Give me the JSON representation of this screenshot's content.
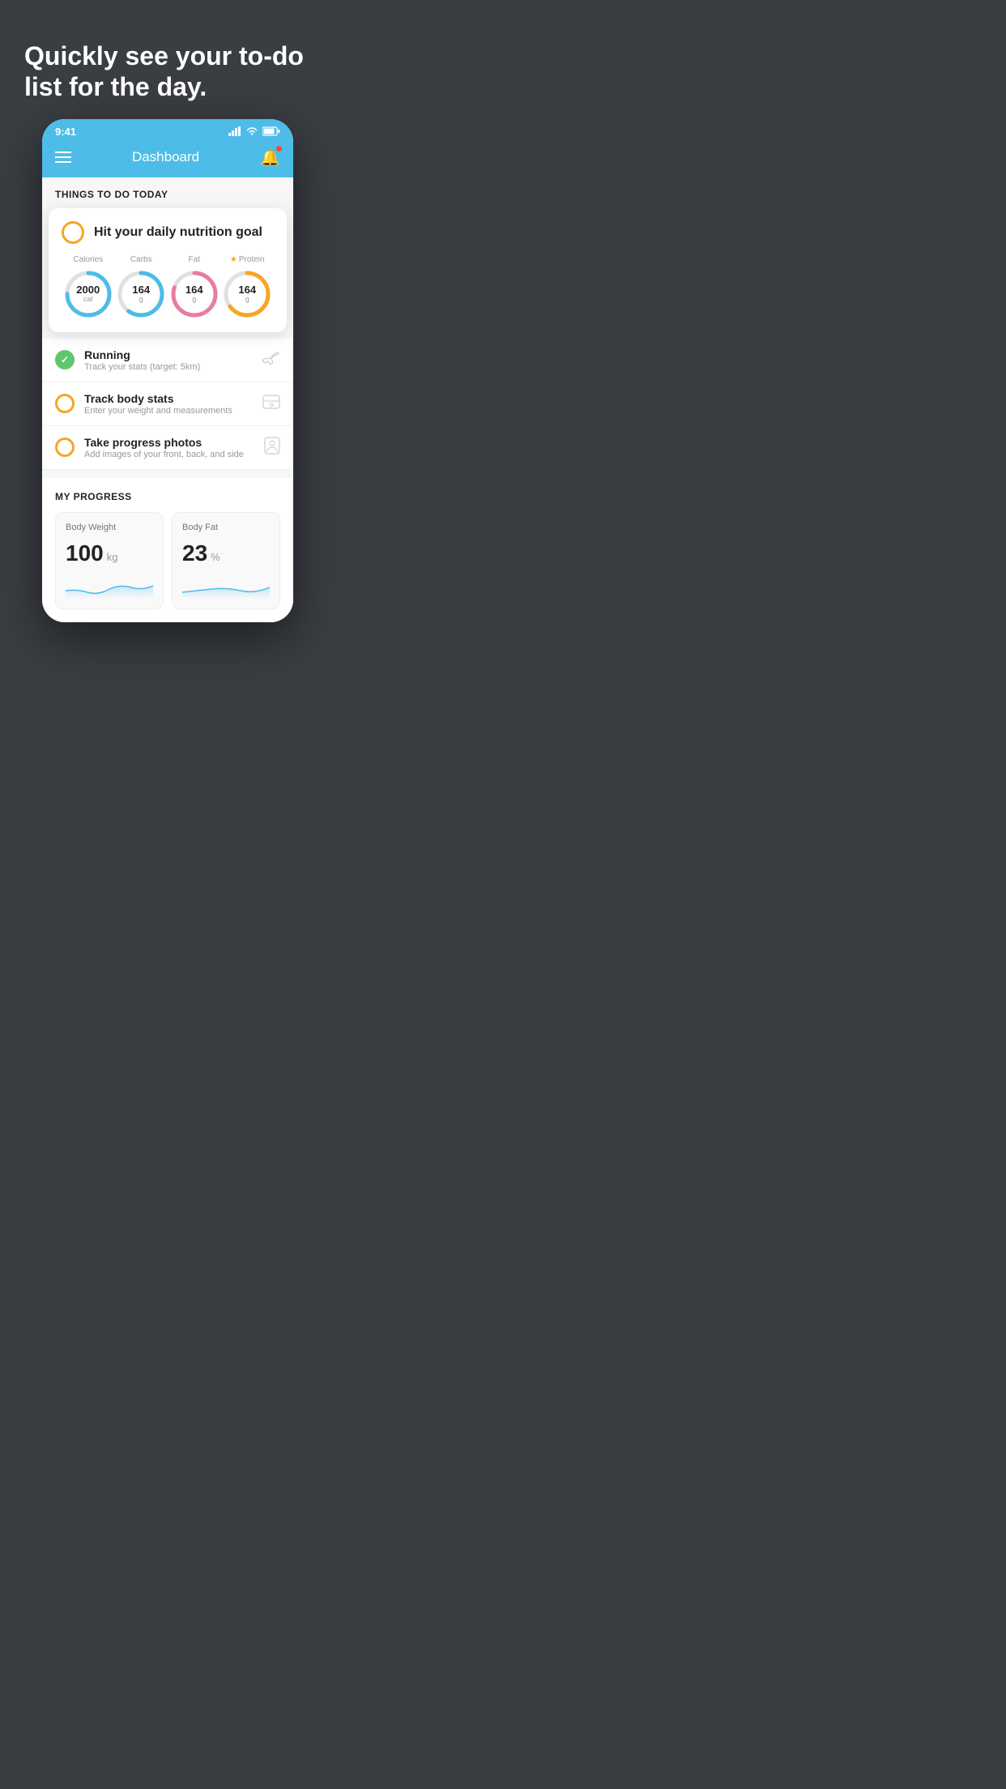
{
  "hero": {
    "title": "Quickly see your to-do list for the day."
  },
  "statusBar": {
    "time": "9:41",
    "signal": "▋▋▋",
    "wifi": "WiFi",
    "battery": "Battery"
  },
  "navbar": {
    "title": "Dashboard",
    "menuLabel": "Menu",
    "notificationLabel": "Notifications"
  },
  "thingsToday": {
    "sectionTitle": "THINGS TO DO TODAY"
  },
  "featuredCard": {
    "title": "Hit your daily nutrition goal",
    "nutrition": [
      {
        "label": "Calories",
        "value": "2000",
        "unit": "cal",
        "color": "#4dbce9",
        "pct": 75
      },
      {
        "label": "Carbs",
        "value": "164",
        "unit": "g",
        "color": "#4dbce9",
        "pct": 60
      },
      {
        "label": "Fat",
        "value": "164",
        "unit": "g",
        "color": "#e87da0",
        "pct": 80
      },
      {
        "label": "Protein",
        "value": "164",
        "unit": "g",
        "color": "#f5a623",
        "pct": 65,
        "starred": true
      }
    ]
  },
  "todoItems": [
    {
      "id": "running",
      "title": "Running",
      "subtitle": "Track your stats (target: 5km)",
      "status": "done",
      "icon": "👟"
    },
    {
      "id": "body-stats",
      "title": "Track body stats",
      "subtitle": "Enter your weight and measurements",
      "status": "pending",
      "icon": "⚖️"
    },
    {
      "id": "photos",
      "title": "Take progress photos",
      "subtitle": "Add images of your front, back, and side",
      "status": "pending",
      "icon": "👤"
    }
  ],
  "progressSection": {
    "title": "MY PROGRESS",
    "cards": [
      {
        "title": "Body Weight",
        "value": "100",
        "unit": "kg"
      },
      {
        "title": "Body Fat",
        "value": "23",
        "unit": "%"
      }
    ]
  }
}
